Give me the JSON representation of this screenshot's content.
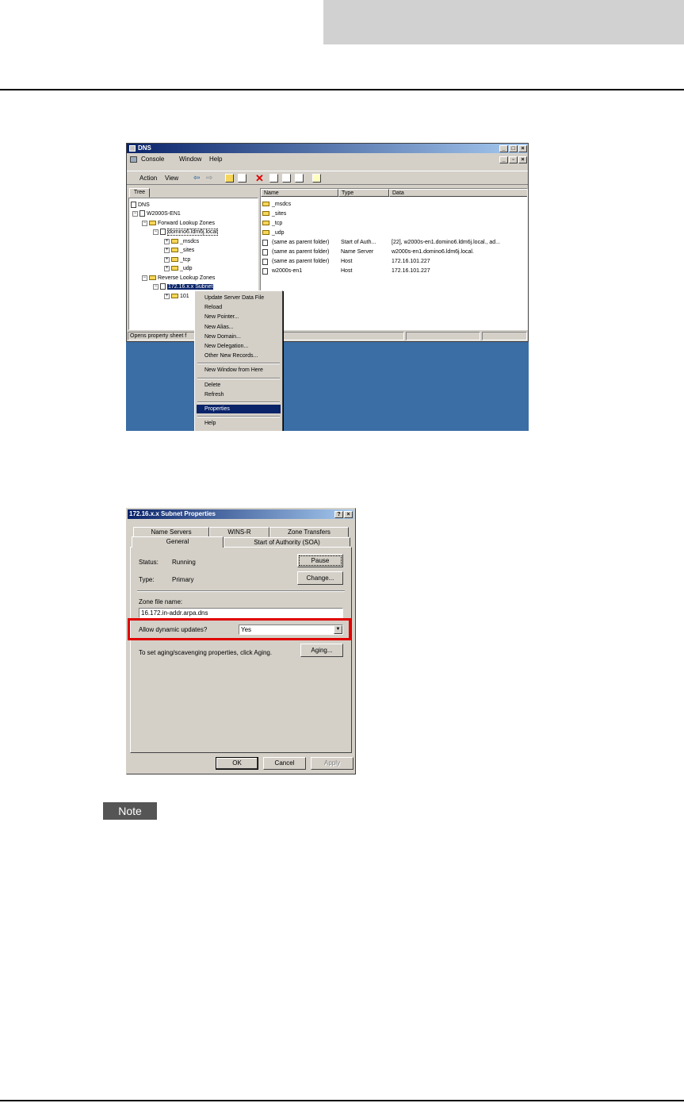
{
  "dns_window": {
    "title": "DNS",
    "menu": [
      "Console",
      "Window",
      "Help"
    ],
    "toolbar": {
      "action": "Action",
      "view": "View"
    },
    "tree_tab": "Tree",
    "tree": {
      "root": "DNS",
      "server": "W2000S-EN1",
      "forward": "Forward Lookup Zones",
      "zone": "domino6.ldm6j.local",
      "sub": [
        "_msdcs",
        "_sites",
        "_tcp",
        "_udp"
      ],
      "reverse": "Reverse Lookup Zones",
      "subnet": "172.16.x.x Subnet",
      "subnet_child": "101"
    },
    "columns": {
      "name": "Name",
      "type": "Type",
      "data": "Data"
    },
    "rows": [
      {
        "name": "_msdcs",
        "type": "",
        "data": ""
      },
      {
        "name": "_sites",
        "type": "",
        "data": ""
      },
      {
        "name": "_tcp",
        "type": "",
        "data": ""
      },
      {
        "name": "_udp",
        "type": "",
        "data": ""
      },
      {
        "name": "(same as parent folder)",
        "type": "Start of Auth...",
        "data": "[22], w2000s-en1.domino6.ldm6j.local., ad..."
      },
      {
        "name": "(same as parent folder)",
        "type": "Name Server",
        "data": "w2000s-en1.domino6.ldm6j.local."
      },
      {
        "name": "(same as parent folder)",
        "type": "Host",
        "data": "172.16.101.227"
      },
      {
        "name": "w2000s-en1",
        "type": "Host",
        "data": "172.16.101.227"
      }
    ],
    "status": "Opens property sheet f",
    "context_menu": {
      "group1": [
        "Update Server Data File",
        "Reload",
        "New Pointer...",
        "New Alias...",
        "New Domain...",
        "New Delegation...",
        "Other New Records..."
      ],
      "group2": [
        "New Window from Here"
      ],
      "group3": [
        "Delete",
        "Refresh"
      ],
      "selected": "Properties",
      "help": "Help"
    },
    "colors": {
      "desktop": "#3a6ea5",
      "title_start": "#0a246a",
      "title_end": "#a6caf0",
      "selection": "#0a246a"
    }
  },
  "properties_dialog": {
    "title": "172.16.x.x Subnet Properties",
    "tabs_back": [
      "Name Servers",
      "WINS-R",
      "Zone Transfers"
    ],
    "tabs_front": [
      "General",
      "Start of Authority (SOA)"
    ],
    "status_label": "Status:",
    "status_value": "Running",
    "pause_button": "Pause",
    "type_label": "Type:",
    "type_value": "Primary",
    "change_button": "Change...",
    "zone_file_label": "Zone file name:",
    "zone_file_value": "16.172.in-addr.arpa.dns",
    "dynamic_label": "Allow dynamic updates?",
    "dynamic_value": "Yes",
    "aging_text": "To set aging/scavenging properties, click Aging.",
    "aging_button": "Aging...",
    "ok": "OK",
    "cancel": "Cancel",
    "apply": "Apply",
    "highlight_color": "#e00000"
  },
  "note": {
    "label": "Note"
  }
}
